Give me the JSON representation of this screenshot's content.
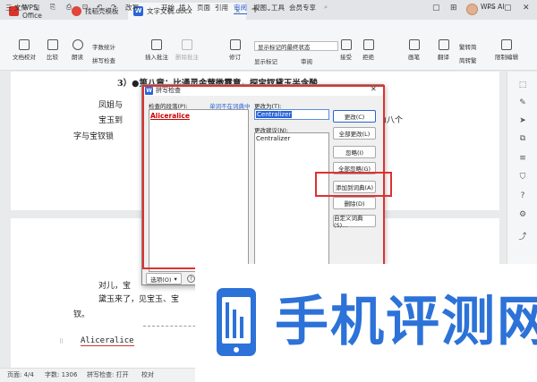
{
  "tabs": [
    {
      "label": "WPS Office",
      "color": "#d9342b"
    },
    {
      "label": "找稻壳模板",
      "color": "#e0443a"
    },
    {
      "label": "文字文稿.docx",
      "color": "#2a64d6"
    }
  ],
  "menu": {
    "file": "三 文件",
    "save_icon": "save-icon",
    "undo": "↶",
    "redo": "↷",
    "change": "改写",
    "items": [
      "开始",
      "插入",
      "页面",
      "引用",
      "审阅",
      "视图",
      "工具",
      "会员专享"
    ],
    "active_index": 4,
    "ai": "WPS AI"
  },
  "ribbon": {
    "doc_proof": "文档校对",
    "compare": "比较",
    "read_aloud": "朗读",
    "word_count": "字数统计",
    "spell_check": "拼写检查",
    "insert_comment": "插入批注",
    "delete_comment": "删除批注",
    "track": "修订",
    "display_mode": "显示标记的最终状态",
    "show_marks": "显示标记",
    "review": "审阅",
    "accept": "接受",
    "reject": "拒绝",
    "compare_docs": "画笔",
    "trad_simp": "翻译",
    "trad": "繁转简",
    "simp": "简转繁",
    "restrict": "限制编辑"
  },
  "document": {
    "heading": "3）●第八章：比通灵金莺微露意，探宝钗黛玉半含酸",
    "line1": "凤姐与",
    "line2": "宝玉到",
    "line2b": "为八个",
    "line3": "字与宝钗锁",
    "p2l1": "对儿，宝",
    "p2l2": "黛玉来了，见宝玉、宝",
    "p2l3": "钗。",
    "misspelled": "Aliceralice"
  },
  "dialog": {
    "title": "拼写检查",
    "close": "✕",
    "notfound_label": "检查的段落(P):",
    "notfound_link": "单词不在词典中",
    "changeto_label": "更改为(T):",
    "changeto_value": "Centralizer",
    "wordlist_item": "Aliceralice",
    "suggestions_label": "更改建议(N):",
    "suggestion": "Centralizer",
    "buttons": {
      "change": "更改(C)",
      "change_all": "全部更改(L)",
      "ignore": "忽略(I)",
      "ignore_all": "全部忽略(G)",
      "add_dict": "添加到词典(A)",
      "delete": "删除(D)",
      "custom_dict": "自定义词典(S)..."
    },
    "options": "选项(O)"
  },
  "status": {
    "page": "页面: 4/4",
    "words": "字数: 1306",
    "spell": "拼写检查: 打开",
    "proof": "校对"
  },
  "watermark": {
    "text": "手机评测网",
    "color": "#2c72d8"
  },
  "colors": {
    "accent": "#2a64d6",
    "highlight": "#e03030"
  }
}
